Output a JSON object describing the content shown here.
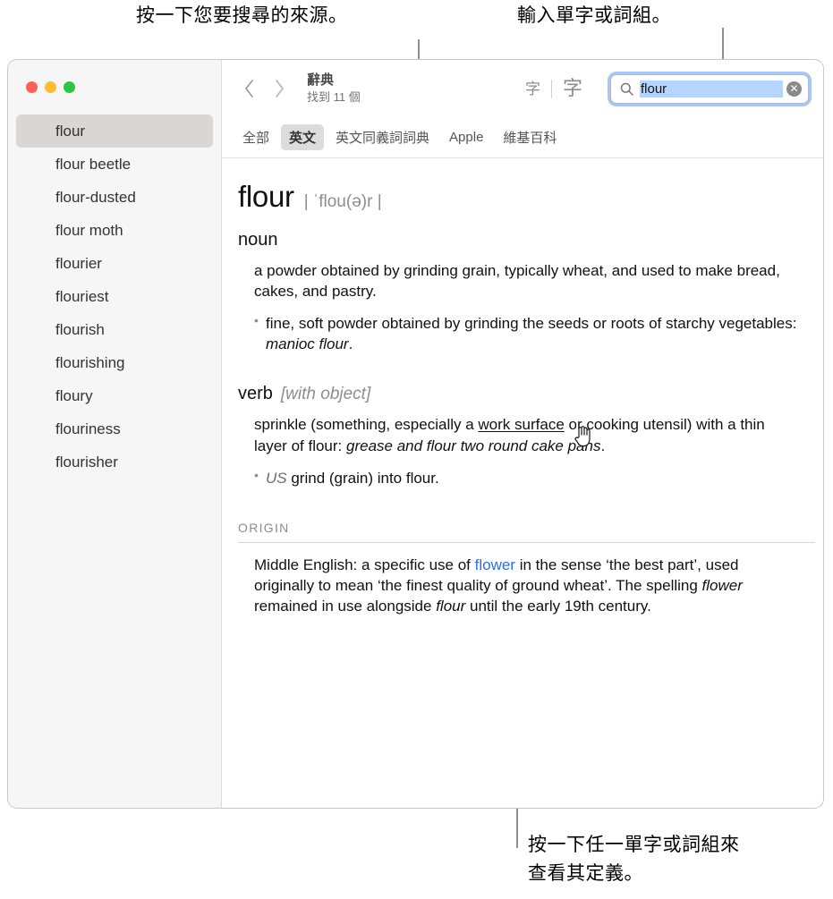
{
  "callouts": {
    "source_tabs": "按一下您要搜尋的來源。",
    "search_field": "輸入單字或詞組。",
    "click_word": "按一下任一單字或詞組來\n查看其定義。"
  },
  "window": {
    "traffic_lights": [
      "close",
      "minimize",
      "zoom"
    ]
  },
  "sidebar": {
    "items": [
      {
        "label": "flour",
        "selected": true
      },
      {
        "label": "flour beetle",
        "selected": false
      },
      {
        "label": "flour-dusted",
        "selected": false
      },
      {
        "label": "flour moth",
        "selected": false
      },
      {
        "label": "flourier",
        "selected": false
      },
      {
        "label": "flouriest",
        "selected": false
      },
      {
        "label": "flourish",
        "selected": false
      },
      {
        "label": "flourishing",
        "selected": false
      },
      {
        "label": "floury",
        "selected": false
      },
      {
        "label": "flouriness",
        "selected": false
      },
      {
        "label": "flourisher",
        "selected": false
      }
    ]
  },
  "toolbar": {
    "back_label": "‹",
    "forward_label": "›",
    "doc_title": "辭典",
    "doc_subtitle": "找到 11 個",
    "font_smaller": "字",
    "font_larger": "字",
    "search": {
      "value": "flour",
      "placeholder": "搜尋",
      "clear_label": "✕"
    }
  },
  "tabs": [
    {
      "label": "全部",
      "active": false
    },
    {
      "label": "英文",
      "active": true
    },
    {
      "label": "英文同義詞詞典",
      "active": false
    },
    {
      "label": "Apple",
      "active": false
    },
    {
      "label": "維基百科",
      "active": false
    }
  ],
  "entry": {
    "headword": "flour",
    "phonetic": "| ˈflou(ə)r |",
    "noun": {
      "pos": "noun",
      "sense": "a powder obtained by grinding grain, typically wheat, and used to make bread, cakes, and pastry.",
      "subsense_prefix": "fine, soft powder obtained by grinding the seeds or roots of starchy vegetables: ",
      "subsense_example": "manioc flour",
      "subsense_suffix": "."
    },
    "verb": {
      "pos": "verb",
      "pos_note": "[with object]",
      "sense_part1": "sprinkle (something, especially a ",
      "sense_link": "work surface",
      "sense_part2": " or cooking utensil) with a thin layer of flour: ",
      "sense_example": "grease and flour two round cake pans",
      "sense_suffix": ".",
      "subsense_region": "US",
      "subsense_text": " grind (grain) into flour."
    },
    "origin": {
      "label": "ORIGIN",
      "part1": "Middle English: a specific use of ",
      "link": "flower",
      "part2": " in the sense ‘the best part’, used originally to mean ‘the finest quality of ground wheat’. The spelling ",
      "italic1": "flower",
      "part3": " remained in use alongside ",
      "italic2": "flour",
      "part4": " until the early 19th century."
    }
  },
  "colors": {
    "link_blue": "#2d6fe0",
    "selection_blue": "#b4d5fe",
    "focus_ring": "#a7c7f7",
    "callout_line": "#8e8e8e"
  }
}
